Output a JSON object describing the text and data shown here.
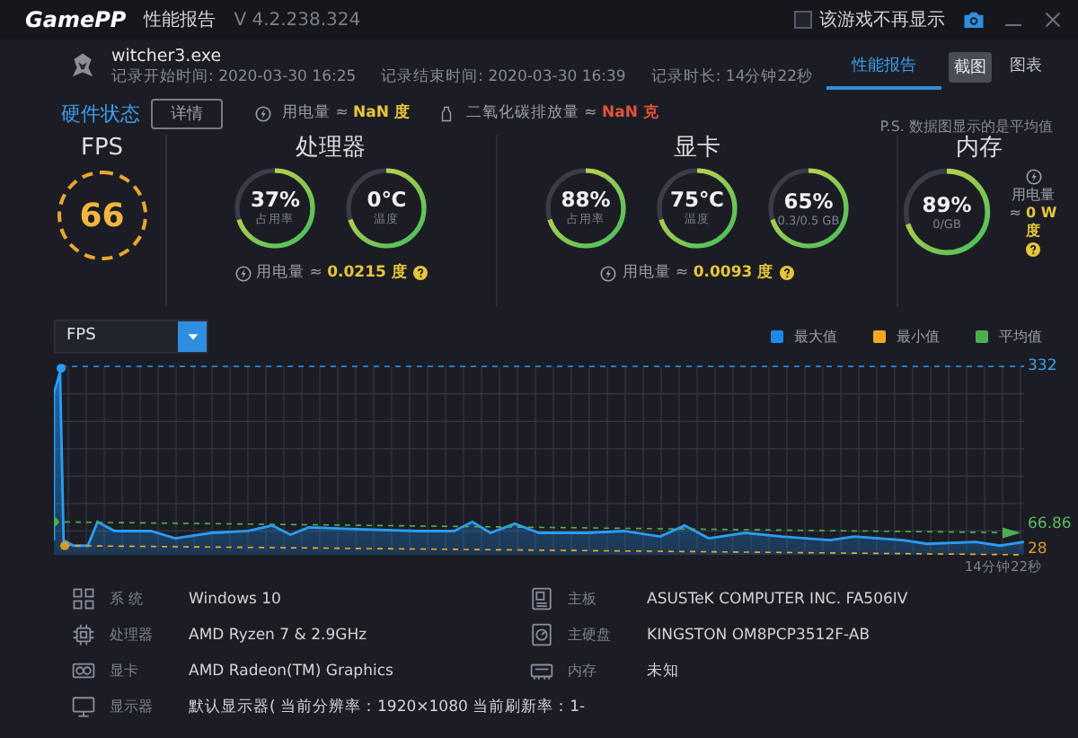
{
  "title_bar": {
    "logo": "GamePP",
    "title": "性能报告",
    "version": "V 4.2.238.324",
    "hide_checkbox": {
      "label": "该游戏不再显示",
      "checked": false
    }
  },
  "session": {
    "exe": "witcher3.exe",
    "start": "记录开始时间: 2020-03-30 16:25",
    "end": "记录结束时间: 2020-03-30 16:39",
    "duration": "记录时长: 14分钟22秒"
  },
  "tabs": [
    {
      "kind": "tab",
      "label": "性能报告",
      "selected": true
    },
    {
      "kind": "button",
      "label": "截图",
      "selected": false
    },
    {
      "kind": "tab",
      "label": "图表",
      "selected": false
    }
  ],
  "hardware": {
    "title": "硬件状态",
    "details_button": "详情",
    "power_label": "用电量 ≈",
    "power_value": "NaN 度",
    "co2_label": "二氧化碳排放量 ≈",
    "co2_value": "NaN 克",
    "note": "P.S. 数据图显示的是平均值"
  },
  "fps": {
    "label": "FPS",
    "value": "66"
  },
  "groups": [
    {
      "title": "处理器",
      "gauges": [
        {
          "value": "37%",
          "caption": "占用率"
        },
        {
          "value": "0℃",
          "caption": "温度"
        }
      ],
      "power_label": "用电量 ≈",
      "power_value": "0.0215 度"
    },
    {
      "title": "显卡",
      "gauges": [
        {
          "value": "88%",
          "caption": "占用率"
        },
        {
          "value": "75℃",
          "caption": "温度"
        },
        {
          "value": "65%",
          "caption": "0.3/0.5 GB"
        }
      ],
      "power_label": "用电量 ≈",
      "power_value": "0.0093 度"
    }
  ],
  "memory": {
    "title": "内存",
    "gauge": {
      "value": "89%",
      "caption": "0/GB"
    },
    "power_label": "用电量 ≈",
    "power_value": "0 W 度"
  },
  "chart": {
    "metric": "FPS",
    "legend": [
      {
        "label": "最大值",
        "color": "#1e88e5"
      },
      {
        "label": "最小值",
        "color": "#f5a623"
      },
      {
        "label": "平均值",
        "color": "#4caf50"
      }
    ],
    "max_label": "332",
    "avg_label": "66.86",
    "min_label": "28",
    "duration": "14分钟22秒"
  },
  "system_info": [
    {
      "kind": "system",
      "label": "系 统",
      "value": "Windows 10"
    },
    {
      "kind": "cpu",
      "label": "处理器",
      "value": "AMD Ryzen 7 & 2.9GHz"
    },
    {
      "kind": "gpu",
      "label": "显卡",
      "value": "AMD Radeon(TM) Graphics"
    },
    {
      "kind": "monitor",
      "label": "显示器",
      "value": "默认显示器( 当前分辨率：1920×1080 当前刷新率：1-"
    },
    {
      "kind": "board",
      "label": "主板",
      "value": "ASUSTeK COMPUTER INC. FA506IV"
    },
    {
      "kind": "disk",
      "label": "主硬盘",
      "value": "KINGSTON OM8PCP3512F-AB"
    },
    {
      "kind": "memory",
      "label": "内存",
      "value": "未知"
    }
  ]
}
